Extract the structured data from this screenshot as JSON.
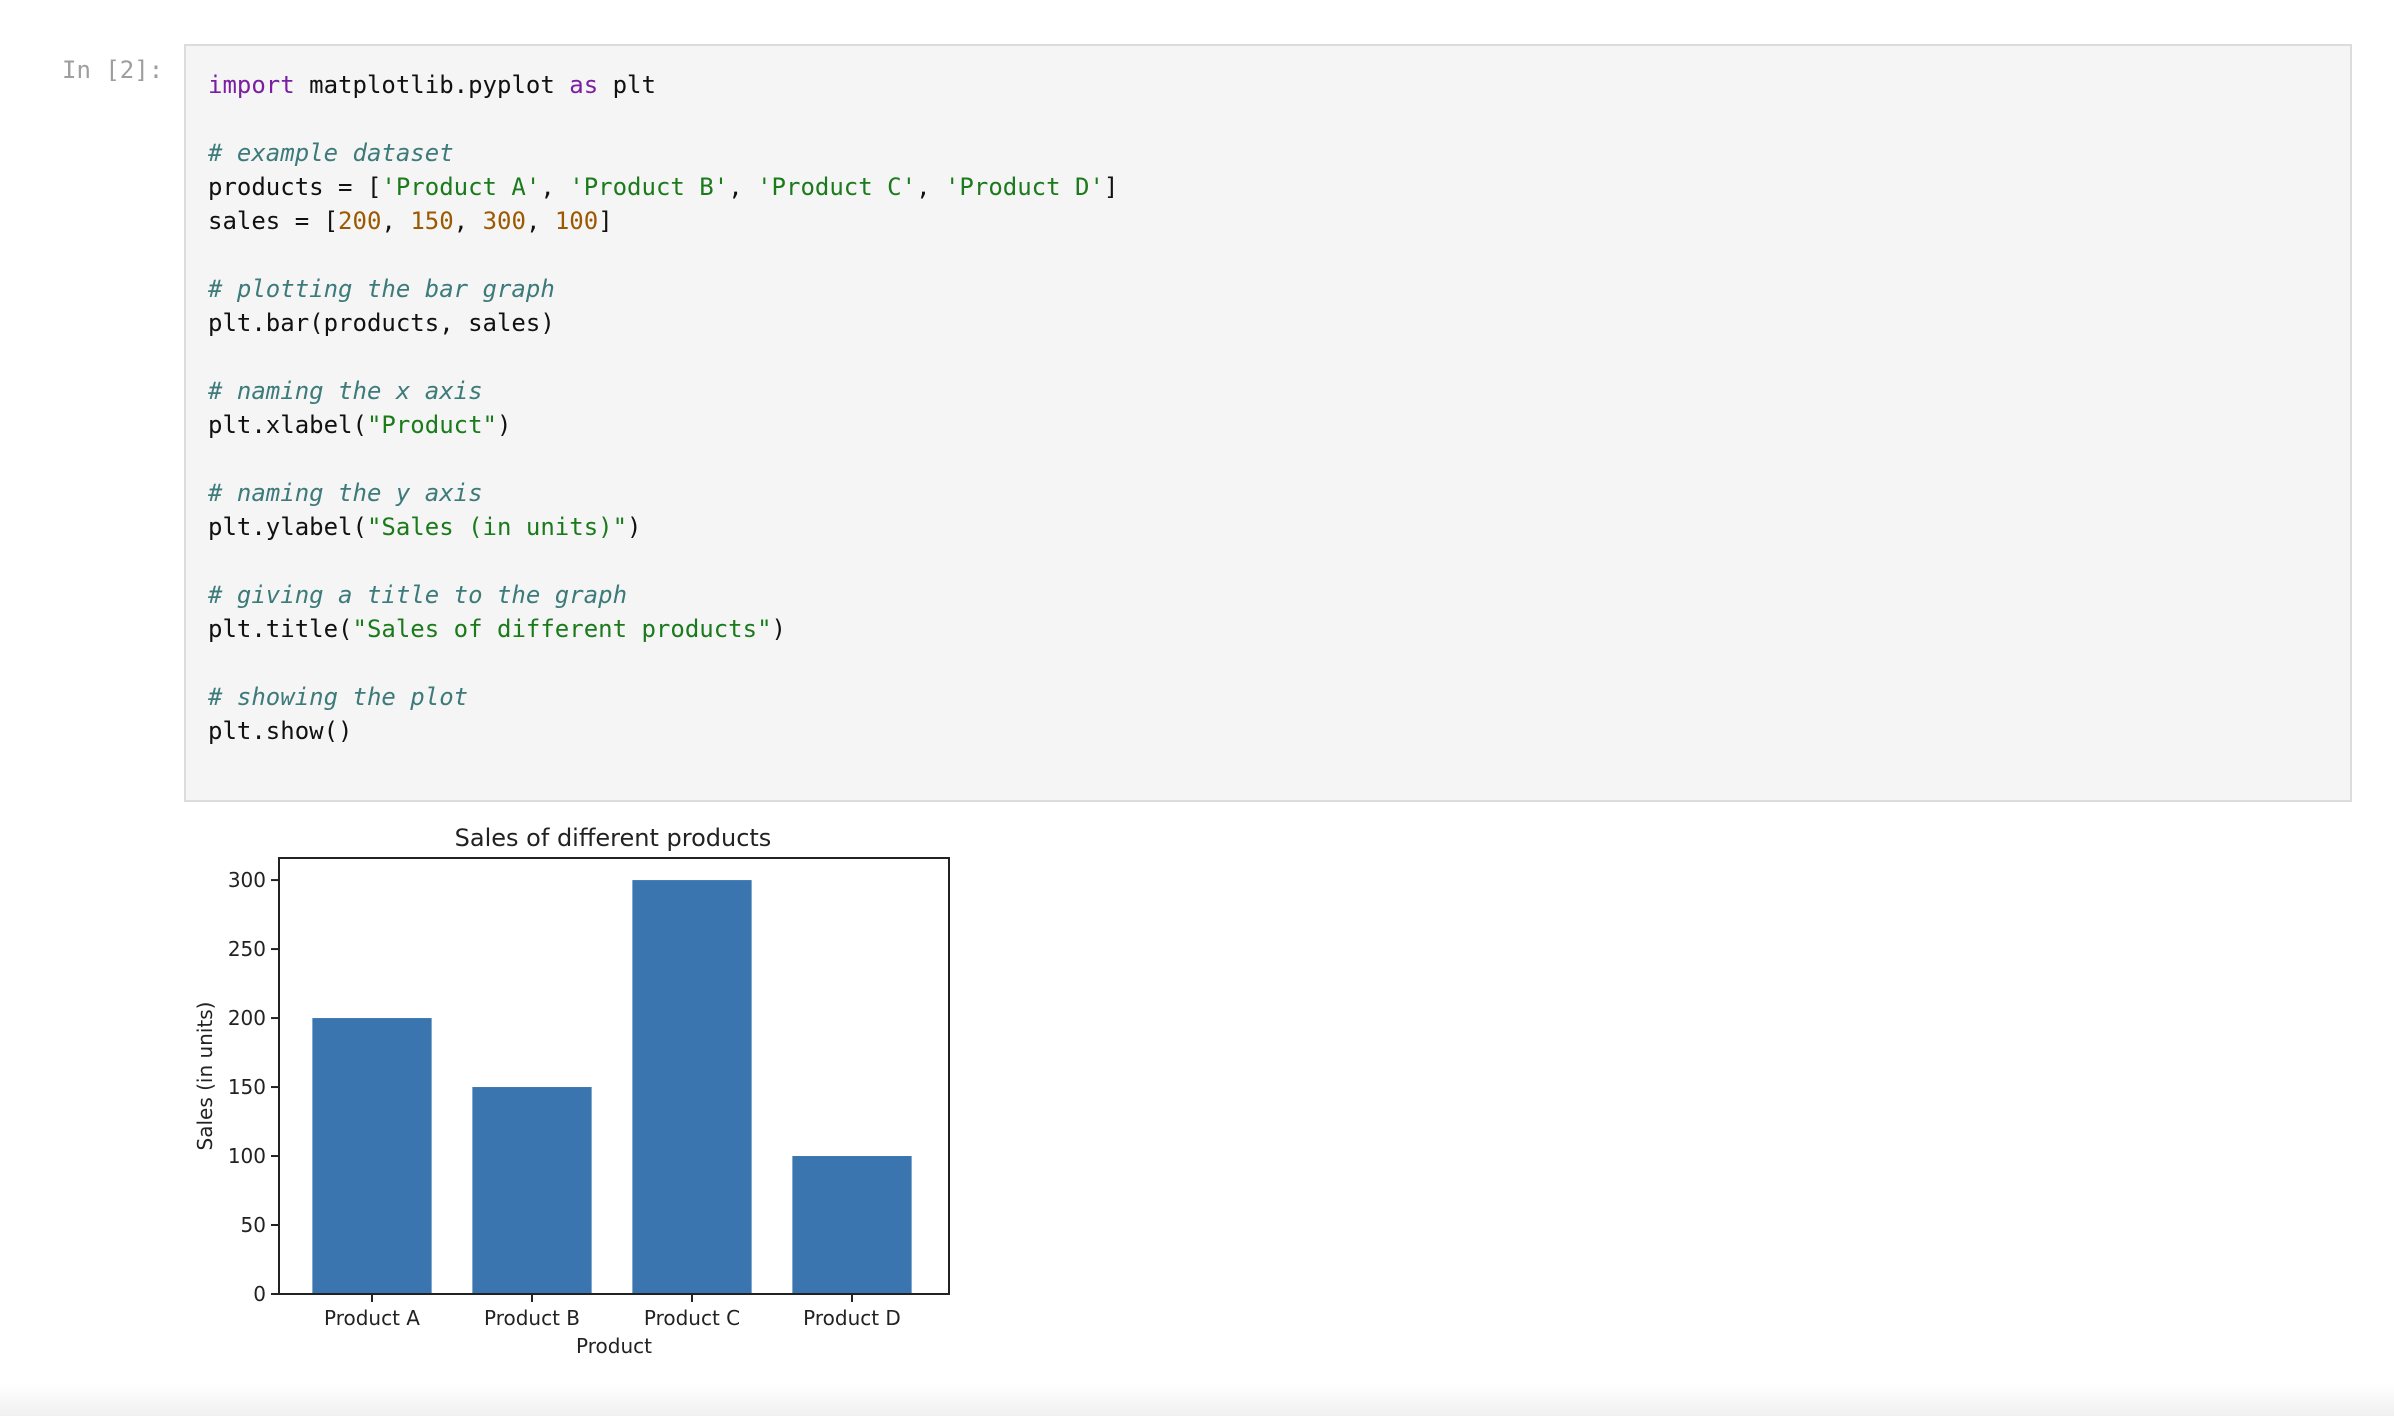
{
  "cell": {
    "prompt": "In [2]:",
    "code_lines": [
      [
        {
          "t": "import",
          "c": "kw"
        },
        {
          "t": " matplotlib.pyplot ",
          "c": ""
        },
        {
          "t": "as",
          "c": "kw"
        },
        {
          "t": " plt",
          "c": ""
        }
      ],
      [],
      [
        {
          "t": "# example dataset",
          "c": "cm"
        }
      ],
      [
        {
          "t": "products = [",
          "c": ""
        },
        {
          "t": "'Product A'",
          "c": "st"
        },
        {
          "t": ", ",
          "c": ""
        },
        {
          "t": "'Product B'",
          "c": "st"
        },
        {
          "t": ", ",
          "c": ""
        },
        {
          "t": "'Product C'",
          "c": "st"
        },
        {
          "t": ", ",
          "c": ""
        },
        {
          "t": "'Product D'",
          "c": "st"
        },
        {
          "t": "]",
          "c": ""
        }
      ],
      [
        {
          "t": "sales = [",
          "c": ""
        },
        {
          "t": "200",
          "c": "nm"
        },
        {
          "t": ", ",
          "c": ""
        },
        {
          "t": "150",
          "c": "nm"
        },
        {
          "t": ", ",
          "c": ""
        },
        {
          "t": "300",
          "c": "nm"
        },
        {
          "t": ", ",
          "c": ""
        },
        {
          "t": "100",
          "c": "nm"
        },
        {
          "t": "]",
          "c": ""
        }
      ],
      [],
      [
        {
          "t": "# plotting the bar graph",
          "c": "cm"
        }
      ],
      [
        {
          "t": "plt.bar(products, sales)",
          "c": ""
        }
      ],
      [],
      [
        {
          "t": "# naming the x axis",
          "c": "cm"
        }
      ],
      [
        {
          "t": "plt.xlabel(",
          "c": ""
        },
        {
          "t": "\"Product\"",
          "c": "st"
        },
        {
          "t": ")",
          "c": ""
        }
      ],
      [],
      [
        {
          "t": "# naming the y axis",
          "c": "cm"
        }
      ],
      [
        {
          "t": "plt.ylabel(",
          "c": ""
        },
        {
          "t": "\"Sales (in units)\"",
          "c": "st"
        },
        {
          "t": ")",
          "c": ""
        }
      ],
      [],
      [
        {
          "t": "# giving a title to the graph",
          "c": "cm"
        }
      ],
      [
        {
          "t": "plt.title(",
          "c": ""
        },
        {
          "t": "\"Sales of different products\"",
          "c": "st"
        },
        {
          "t": ")",
          "c": ""
        }
      ],
      [],
      [
        {
          "t": "# showing the plot",
          "c": "cm"
        }
      ],
      [
        {
          "t": "plt.show()",
          "c": ""
        }
      ]
    ]
  },
  "chart_data": {
    "type": "bar",
    "title": "Sales of different products",
    "xlabel": "Product",
    "ylabel": "Sales (in units)",
    "categories": [
      "Product A",
      "Product B",
      "Product C",
      "Product D"
    ],
    "values": [
      200,
      150,
      300,
      100
    ],
    "ylim": [
      0,
      316
    ],
    "yticks": [
      0,
      50,
      100,
      150,
      200,
      250,
      300
    ],
    "bar_color": "#3a75b0",
    "grid": false
  }
}
